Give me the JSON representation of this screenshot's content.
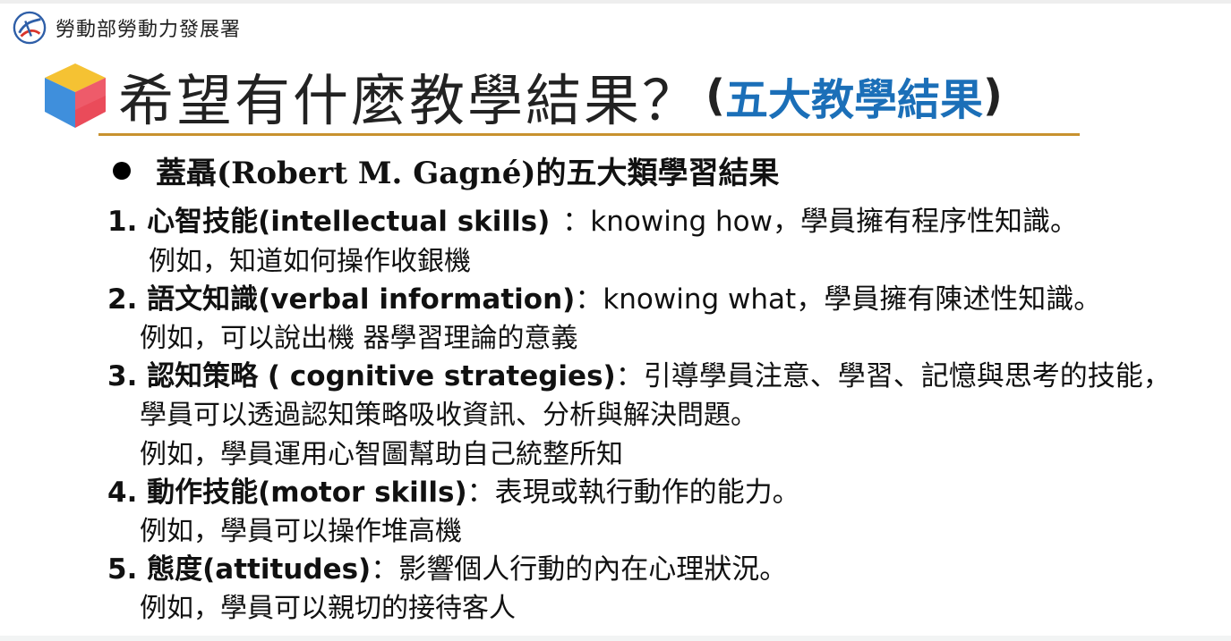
{
  "org": {
    "name": "勞動部勞動力發展署",
    "logo_icon": "ministry-logo-icon"
  },
  "title": {
    "main": "希望有什麼教學結果？",
    "paren_open": "(",
    "sub": "五大教學結果",
    "paren_close": ")",
    "icon": "cube-icon"
  },
  "bullet": {
    "text": "蓋聶(Robert M. Gagné)的五大類學習結果"
  },
  "outcomes": [
    {
      "head": "1. 心智技能(intellectual skills)",
      "desc": "：knowing how，學員擁有程序性知識。",
      "extra": "",
      "example": "例如，知道如何操作收銀機"
    },
    {
      "head": "2. 語文知識(verbal information)",
      "desc": "：knowing what，學員擁有陳述性知識。",
      "extra": "",
      "example": "例如，可以說出機 器學習理論的意義"
    },
    {
      "head": "3. 認知策略 ( cognitive strategies)",
      "desc": "：引導學員注意、學習、記憶與思考的技能，",
      "extra": "學員可以透過認知策略吸收資訊、分析與解決問題。",
      "example": "例如，學員運用心智圖幫助自己統整所知"
    },
    {
      "head": "4. 動作技能(motor skills)",
      "desc": "：表現或執行動作的能力。",
      "extra": "",
      "example": "例如，學員可以操作堆高機"
    },
    {
      "head": "5. 態度(attitudes)",
      "desc": "：影響個人行動的內在心理狀況。",
      "extra": "",
      "example": "例如，學員可以親切的接待客人"
    }
  ],
  "colors": {
    "accent_blue": "#1b6fb8",
    "rule_gold": "#c8922f",
    "text": "#111111"
  }
}
